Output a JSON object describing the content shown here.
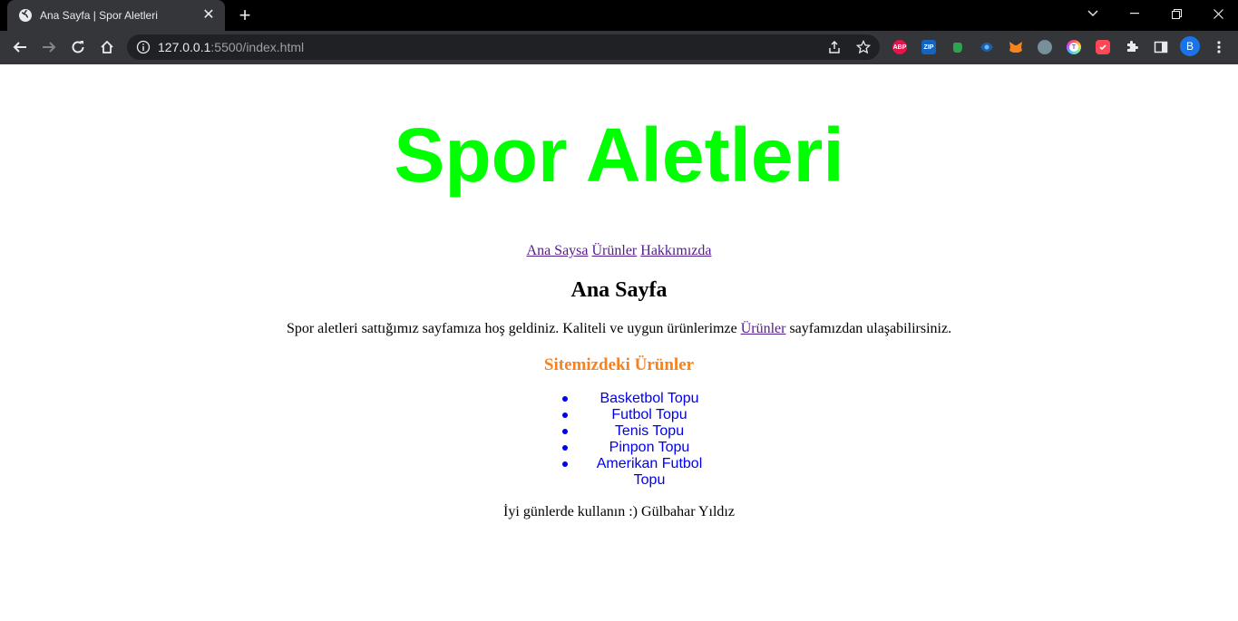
{
  "browser": {
    "tab_title": "Ana Sayfa | Spor Aletleri",
    "url_host": "127.0.0.1",
    "url_path": ":5500/index.html",
    "profile_initial": "B",
    "extensions": [
      {
        "name": "abp",
        "label": "ABP",
        "color": "#e8124a"
      },
      {
        "name": "zip",
        "label": "ZIP",
        "color": "#1565c0"
      },
      {
        "name": "evernote",
        "label": "",
        "color": "#2ea44f"
      },
      {
        "name": "eye",
        "label": "",
        "color": "#1e88e5"
      },
      {
        "name": "metamask",
        "label": "",
        "color": "#f6851b"
      },
      {
        "name": "globe-ext",
        "label": "",
        "color": "#78909c"
      },
      {
        "name": "t-ext",
        "label": "T",
        "color": "#7c4dff"
      },
      {
        "name": "todo-ext",
        "label": "",
        "color": "#ff4757"
      }
    ]
  },
  "page": {
    "site_title": "Spor Aletleri",
    "title_color": "#00ff00",
    "nav": [
      "Ana Saysa",
      "Ürünler",
      "Hakkımızda"
    ],
    "heading": "Ana Sayfa",
    "intro_before": "Spor aletleri sattığımız sayfamıza hoş geldiniz. Kaliteli ve uygun ürünlerimze ",
    "intro_link": "Ürünler",
    "intro_after": " sayfamızdan ulaşabilirsiniz.",
    "products_heading": "Sitemizdeki Ürünler",
    "products_heading_color": "#f5821f",
    "products_color": "#0000ee",
    "products": [
      "Basketbol Topu",
      "Futbol Topu",
      "Tenis Topu",
      "Pinpon Topu",
      "Amerikan Futbol Topu"
    ],
    "footer_note": "İyi günlerde kullanın :) Gülbahar Yıldız"
  }
}
